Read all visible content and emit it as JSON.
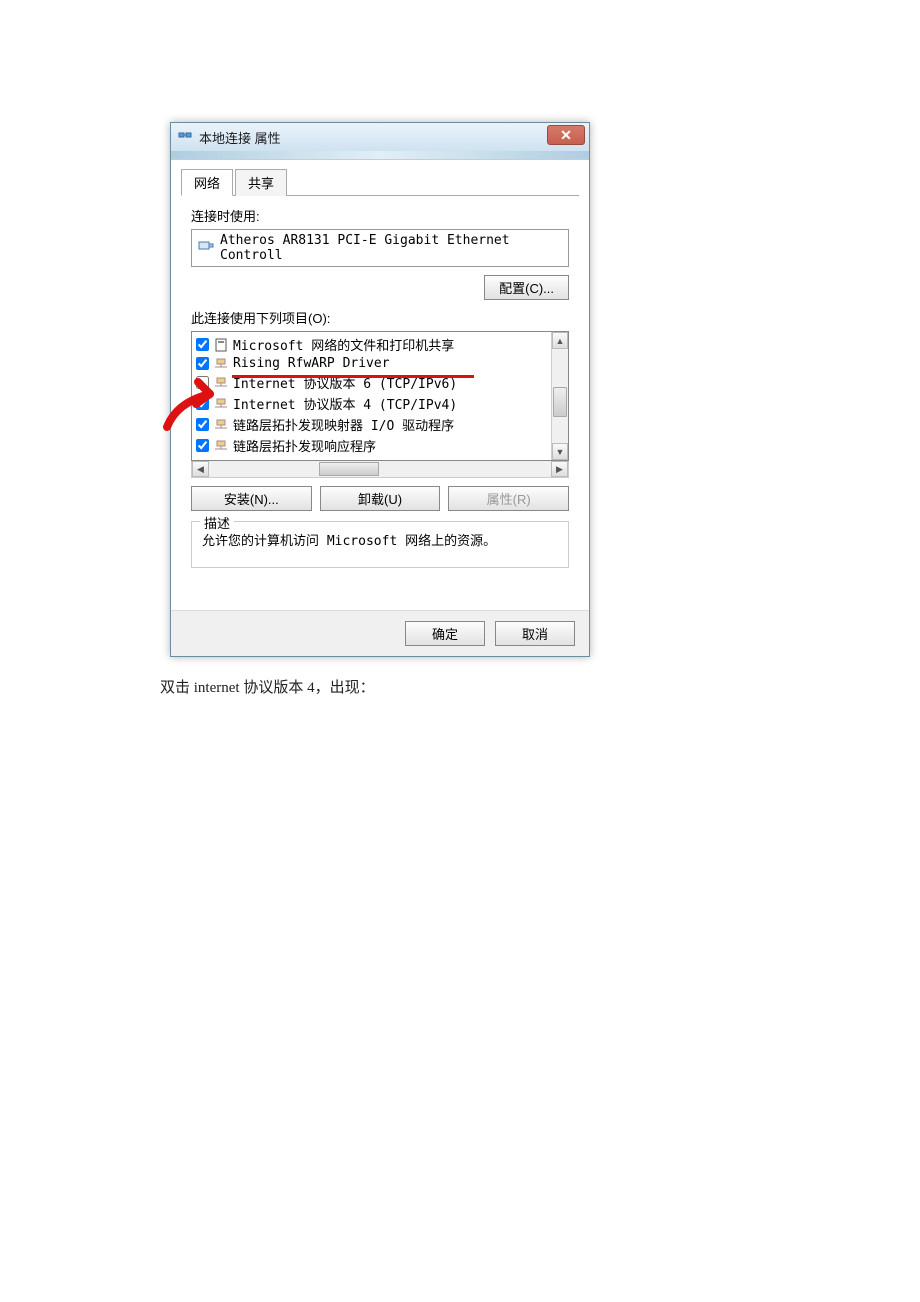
{
  "dialog": {
    "title": "本地连接 属性",
    "tabs": [
      "网络",
      "共享"
    ],
    "connect_using_label": "连接时使用:",
    "adapter": "Atheros AR8131 PCI-E Gigabit Ethernet Controll",
    "configure_btn": "配置(C)...",
    "items_label": "此连接使用下列项目(O):",
    "list": [
      {
        "checked": true,
        "icon": "doc",
        "label": "Microsoft 网络的文件和打印机共享"
      },
      {
        "checked": true,
        "icon": "net",
        "label": "Rising RfwARP Driver"
      },
      {
        "checked": false,
        "icon": "net",
        "label": "Internet 协议版本 6 (TCP/IPv6)"
      },
      {
        "checked": true,
        "icon": "net",
        "label": "Internet 协议版本 4 (TCP/IPv4)"
      },
      {
        "checked": true,
        "icon": "net",
        "label": "链路层拓扑发现映射器 I/O 驱动程序"
      },
      {
        "checked": true,
        "icon": "net",
        "label": "链路层拓扑发现响应程序"
      }
    ],
    "install_btn": "安装(N)...",
    "uninstall_btn": "卸载(U)",
    "properties_btn": "属性(R)",
    "desc_legend": "描述",
    "desc_text": "允许您的计算机访问 Microsoft 网络上的资源。",
    "ok_btn": "确定",
    "cancel_btn": "取消"
  },
  "caption": "双击 internet 协议版本 4，出现："
}
